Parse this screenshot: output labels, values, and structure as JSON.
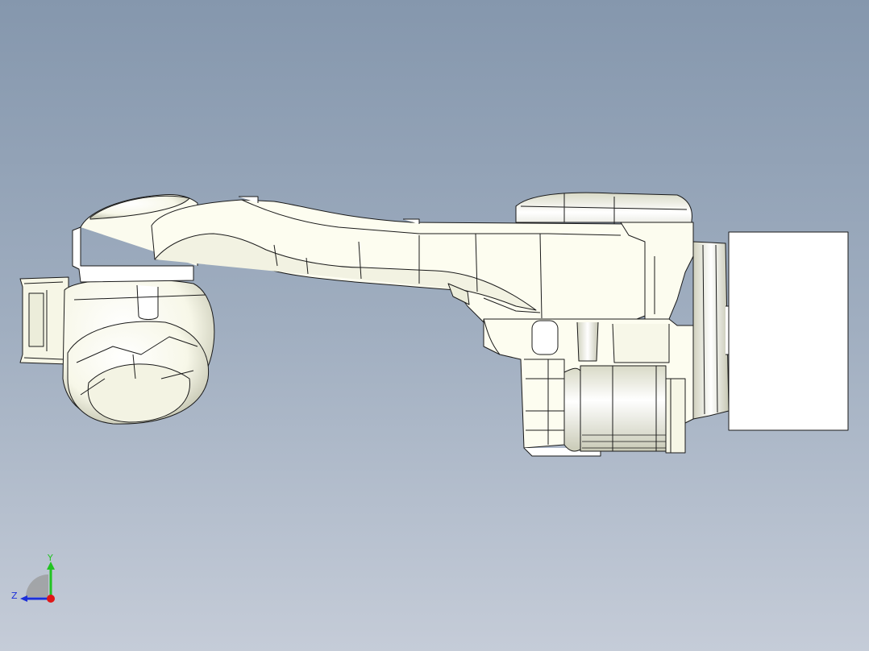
{
  "viewport": {
    "background_top": "#8597ad",
    "background_bottom": "#c5ccd8"
  },
  "model": {
    "part_fill": "#fdfdf0",
    "edge_color": "#1a1a1a",
    "shade_color": "#d7d8c4"
  },
  "triad": {
    "y_label": "Y",
    "z_label": "Z",
    "y_color": "#22c322",
    "z_color": "#1c2fd9",
    "x_color": "#e01616"
  }
}
